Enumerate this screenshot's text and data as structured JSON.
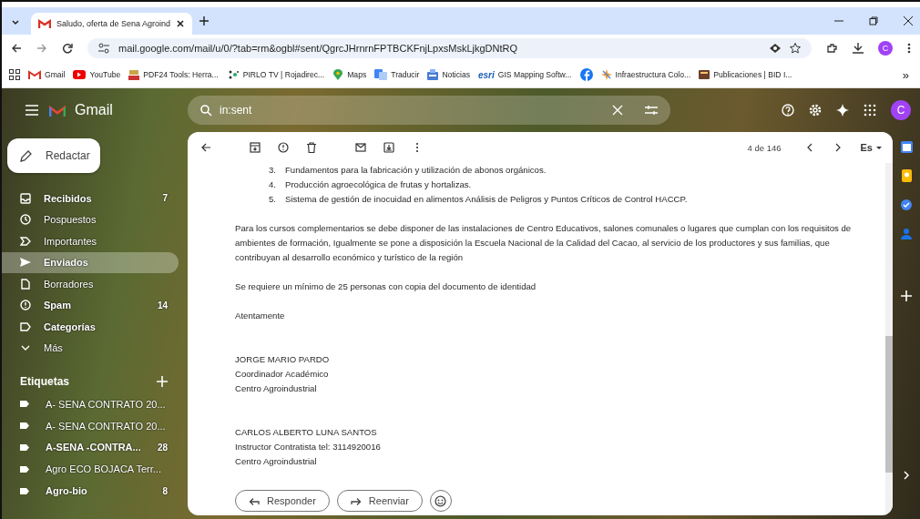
{
  "browser": {
    "tabs": [
      {
        "title": "Saludo, oferta de Sena Agroind",
        "selected": true
      }
    ],
    "url": "mail.google.com/mail/u/0/?tab=rm&ogbl#sent/QgrcJHrnrnFPTBCKFnjLpxsMskLjkgDNtRQ",
    "profile": "C",
    "bookmarks": [
      {
        "kind": "gmail",
        "label": "Gmail"
      },
      {
        "kind": "youtube",
        "label": "YouTube"
      },
      {
        "kind": "pdf",
        "label": "PDF24 Tools: Herra..."
      },
      {
        "kind": "dots",
        "label": "PIRLO TV | Rojadirec..."
      },
      {
        "kind": "pin",
        "label": "Maps"
      },
      {
        "kind": "translate",
        "label": "Traducir"
      },
      {
        "kind": "news",
        "label": "Noticias"
      },
      {
        "kind": "esri",
        "logo_text": "esri",
        "label": "GIS Mapping Softw..."
      },
      {
        "kind": "facebook"
      },
      {
        "kind": "star",
        "label": "Infraestructura Colo..."
      },
      {
        "kind": "book",
        "label": "Publicaciones | BID I..."
      }
    ],
    "more": "»"
  },
  "gmail": {
    "app_name": "Gmail",
    "search": "in:sent",
    "avatar": "C",
    "compose": "Redactar",
    "nav": [
      {
        "kind": "inbox",
        "label": "Recibidos",
        "count": "7",
        "bold": true,
        "selected": false
      },
      {
        "kind": "clock",
        "label": "Pospuestos",
        "bold": false,
        "selected": false
      },
      {
        "kind": "important",
        "label": "Importantes",
        "bold": false,
        "selected": false
      },
      {
        "kind": "send",
        "label": "Enviados",
        "bold": true,
        "selected": true
      },
      {
        "kind": "draft",
        "label": "Borradores",
        "bold": false,
        "selected": false
      },
      {
        "kind": "spam",
        "label": "Spam",
        "count": "14",
        "bold": true,
        "selected": false
      },
      {
        "kind": "label",
        "label": "Categorías",
        "bold": true,
        "selected": false
      },
      {
        "kind": "chevron",
        "label": "Más",
        "bold": false,
        "selected": false
      }
    ],
    "labels_heading": "Etiquetas",
    "labels": [
      {
        "label": "A- SENA CONTRATO 20...",
        "bold": false
      },
      {
        "label": "A- SENA CONTRATO 20...",
        "bold": false
      },
      {
        "label": "A-SENA -CONTRA...",
        "count": "28",
        "bold": true
      },
      {
        "label": "Agro ECO BOJACA Terr...",
        "bold": false
      },
      {
        "label": "Agro-bio",
        "count": "8",
        "bold": true
      }
    ],
    "counter": "4 de 146",
    "language": "Es",
    "body": [
      {
        "kind": "item",
        "number": "3.",
        "text": "Fundamentos para la fabricación y utilización de abonos orgánicos."
      },
      {
        "kind": "item",
        "number": "4.",
        "text": "Producción agroecológica de frutas y hortalizas."
      },
      {
        "kind": "item",
        "number": "5.",
        "text": "Sistema de gestión de inocuidad en alimentos Análisis de Peligros y Puntos Críticos de Control HACCP."
      },
      {
        "kind": "gap"
      },
      {
        "kind": "para",
        "text": "Para los cursos complementarios se debe disponer de las instalaciones de Centro Educativos, salones comunales o lugares que cumplan con los requisitos de ambientes de formación, Igualmente se pone a disposición la Escuela Nacional de la Calidad del Cacao, al servicio de los productores y sus familias, que contribuyan al desarrollo económico y turístico de la región"
      },
      {
        "kind": "gap"
      },
      {
        "kind": "para",
        "text": "Se requiere un mínimo de 25 personas con copia del documento de identidad"
      },
      {
        "kind": "gap"
      },
      {
        "kind": "para",
        "text": "Atentamente"
      },
      {
        "kind": "gap"
      },
      {
        "kind": "gap"
      },
      {
        "kind": "para",
        "text": "JORGE MARIO PARDO"
      },
      {
        "kind": "para",
        "text": "Coordinador Académico"
      },
      {
        "kind": "para",
        "text": "Centro Agroindustrial"
      },
      {
        "kind": "gap"
      },
      {
        "kind": "gap"
      },
      {
        "kind": "para",
        "text": "CARLOS ALBERTO LUNA SANTOS"
      },
      {
        "kind": "para",
        "text": "Instructor Contratista tel: 3114920016"
      },
      {
        "kind": "para",
        "text": "Centro Agroindustrial"
      }
    ],
    "actions": [
      {
        "kind": "reply",
        "label": "Responder"
      },
      {
        "kind": "forward",
        "label": "Reenviar"
      },
      {
        "kind": "emoji"
      }
    ]
  }
}
